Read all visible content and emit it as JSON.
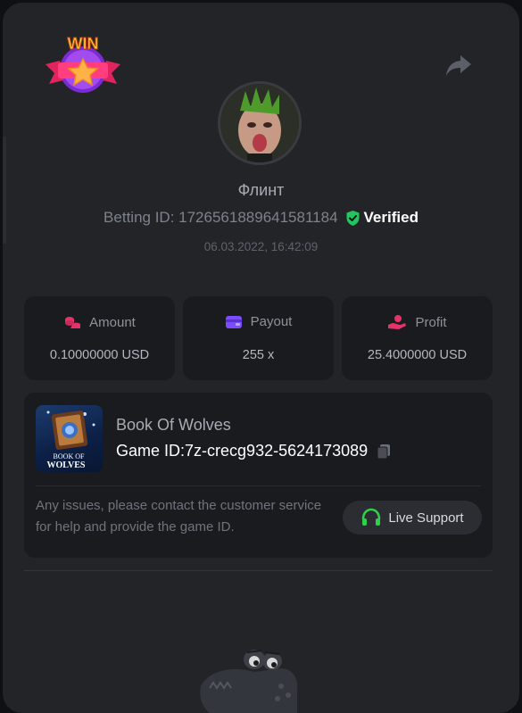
{
  "header": {
    "badge_text": "WIN"
  },
  "player": {
    "name": "Флинт",
    "betting_id": "Betting ID: 1726561889641581184",
    "verified_label": "Verified",
    "datetime": "06.03.2022, 16:42:09"
  },
  "stats": [
    {
      "label": "Amount",
      "value": "0.10000000 USD",
      "icon": "coins-icon",
      "color": "#e5336a"
    },
    {
      "label": "Payout",
      "value": "255 x",
      "icon": "wallet-icon",
      "color": "#7b4dff"
    },
    {
      "label": "Profit",
      "value": "25.4000000 USD",
      "icon": "hand-profit-icon",
      "color": "#e5336a"
    }
  ],
  "game": {
    "name": "Book Of Wolves",
    "id_label": "Game ID:",
    "id_value": "7z-crecg932-5624173089",
    "thumb_text_1": "BOOK OF",
    "thumb_text_2": "WOLVES"
  },
  "support": {
    "message": "Any issues, please contact the customer service for help and provide the game ID.",
    "button_label": "Live Support"
  },
  "colors": {
    "accent_green": "#2fd14a",
    "verified_green": "#22c55e",
    "background": "#232428",
    "card": "#1a1b1f"
  }
}
